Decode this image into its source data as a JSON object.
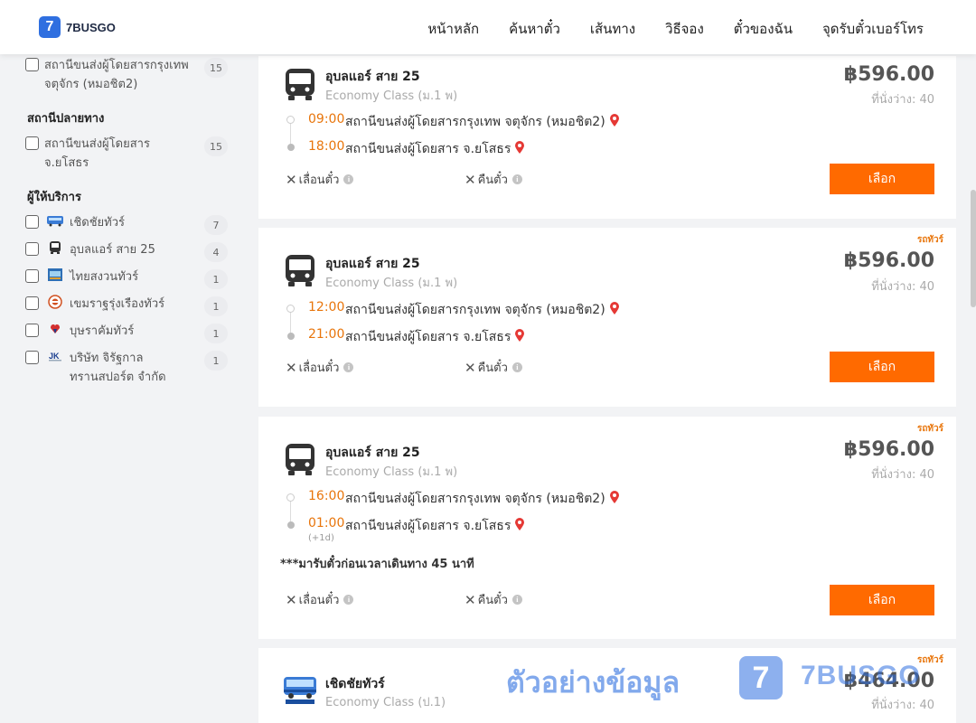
{
  "header": {
    "logo_mark": "7",
    "logo_text": "7BUSGO",
    "nav": [
      "หน้าหลัก",
      "ค้นหาตั๋ว",
      "เส้นทาง",
      "วิธีจอง",
      "ตั๋วของฉัน",
      "จุดรับตั๋วเบอร์โทร"
    ]
  },
  "sidebar": {
    "departure_item": {
      "label": "สถานีขนส่งผู้โดยสารกรุงเทพ จตุจักร (หมอชิต2)",
      "count": "15"
    },
    "arrival_title": "สถานีปลายทาง",
    "arrival_item": {
      "label": "สถานีขนส่งผู้โดยสาร จ.ยโสธร",
      "count": "15"
    },
    "operators_title": "ผู้ให้บริการ",
    "operators": [
      {
        "label": "เชิดชัยทัวร์",
        "count": "7",
        "icon": "cherdchai-logo-icon"
      },
      {
        "label": "อุบลแอร์ สาย 25",
        "count": "4",
        "icon": "bus-icon"
      },
      {
        "label": "ไทยสงวนทัวร์",
        "count": "1",
        "icon": "thaisanguan-logo-icon"
      },
      {
        "label": "เขมราฐรุ่งเรืองทัวร์",
        "count": "1",
        "icon": "khemarat-logo-icon"
      },
      {
        "label": "บุษราคัมทัวร์",
        "count": "1",
        "icon": "busarakham-logo-icon"
      },
      {
        "label": "บริษัท จิรัฐกาล ทรานสปอร์ต จำกัด",
        "count": "1",
        "icon": "jk-logo-icon"
      }
    ]
  },
  "trips": [
    {
      "operator": "อุบลแอร์ สาย 25",
      "class": "Economy Class (ม.1 พ)",
      "price": "฿596.00",
      "seats": "ที่นั่งว่าง: 40",
      "tag": "",
      "depart_time": "09:00",
      "depart_station": "สถานีขนส่งผู้โดยสารกรุงเทพ จตุจักร (หมอชิต2)",
      "arrive_time": "18:00",
      "arrive_station": "สถานีขนส่งผู้โดยสาร จ.ยโสธร",
      "reschedule": "เลื่อนตั๋ว",
      "refund": "คืนตั๋ว",
      "button": "เลือก"
    },
    {
      "operator": "อุบลแอร์ สาย 25",
      "class": "Economy Class (ม.1 พ)",
      "price": "฿596.00",
      "seats": "ที่นั่งว่าง: 40",
      "tag": "รถทัวร์",
      "depart_time": "12:00",
      "depart_station": "สถานีขนส่งผู้โดยสารกรุงเทพ จตุจักร (หมอชิต2)",
      "arrive_time": "21:00",
      "arrive_station": "สถานีขนส่งผู้โดยสาร จ.ยโสธร",
      "reschedule": "เลื่อนตั๋ว",
      "refund": "คืนตั๋ว",
      "button": "เลือก"
    },
    {
      "operator": "อุบลแอร์ สาย 25",
      "class": "Economy Class (ม.1 พ)",
      "price": "฿596.00",
      "seats": "ที่นั่งว่าง: 40",
      "tag": "รถทัวร์",
      "depart_time": "16:00",
      "depart_station": "สถานีขนส่งผู้โดยสารกรุงเทพ จตุจักร (หมอชิต2)",
      "arrive_time": "01:00",
      "arrive_station": "สถานีขนส่งผู้โดยสาร จ.ยโสธร",
      "next_day": "(+1d)",
      "notice": "***มารับตั๋วก่อนเวลาเดินทาง 45 นาที",
      "reschedule": "เลื่อนตั๋ว",
      "refund": "คืนตั๋ว",
      "button": "เลือก"
    },
    {
      "operator": "เชิดชัยทัวร์",
      "class": "Economy Class (ป.1)",
      "price": "฿464.00",
      "seats": "ที่นั่งว่าง: 40",
      "tag": "รถทัวร์"
    }
  ],
  "watermark": {
    "text": "ตัวอย่างข้อมูล",
    "mark": "7",
    "brand": "7BUSGO"
  },
  "colors": {
    "accent": "#ff6a00",
    "time": "#e8750b",
    "brand": "#2f6fe0",
    "pin": "#e53935"
  }
}
